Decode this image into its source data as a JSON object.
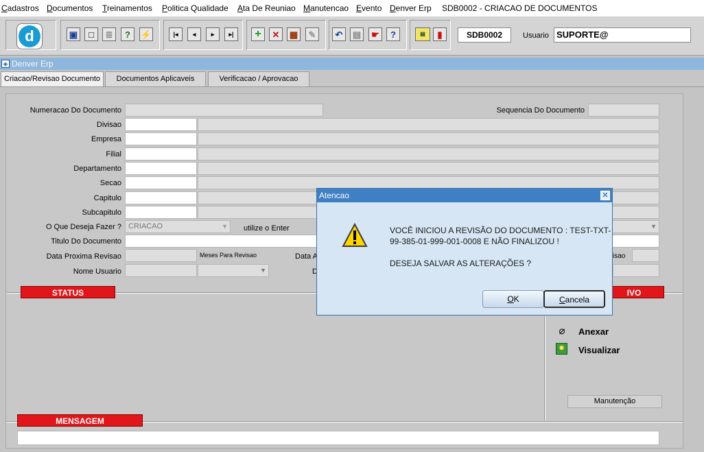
{
  "menubar": {
    "items": [
      {
        "first": "C",
        "rest": "adastros"
      },
      {
        "first": "D",
        "rest": "ocumentos"
      },
      {
        "first": "T",
        "rest": "reinamentos"
      },
      {
        "first": "P",
        "rest": "olitica Qualidade"
      },
      {
        "first": "A",
        "rest": "ta De Reuniao"
      },
      {
        "first": "M",
        "rest": "anutencao"
      },
      {
        "first": "E",
        "rest": "vento"
      },
      {
        "first": "D",
        "rest": "enver Erp"
      }
    ],
    "form_title": "SDB0002 - CRIACAO DE DOCUMENTOS"
  },
  "toolbar": {
    "form_code": "SDB0002",
    "user_label": "Usuario",
    "user_value": "SUPORTE@"
  },
  "window": {
    "title": "Denver Erp"
  },
  "tabs": [
    {
      "label": "Criacao/Revisao Documento"
    },
    {
      "label": "Documentos Aplicaveis"
    },
    {
      "label": "Verificacao / Aprovacao"
    }
  ],
  "form": {
    "numeracao_label": "Numeracao Do Documento",
    "sequencia_label": "Sequencia Do Documento",
    "divisao_label": "Divisao",
    "empresa_label": "Empresa",
    "filial_label": "Filial",
    "departamento_label": "Departamento",
    "secao_label": "Secao",
    "capitulo_label": "Capitulo",
    "subcapitulo_label": "Subcapitulo",
    "acao_label": "O Que Deseja Fazer ?",
    "acao_value": "CRIACAO",
    "acao_hint": "utilize o Enter",
    "titulo_label": "Titulo Do Documento",
    "data_proxima_label": "Data Proxima Revisao",
    "meses_label": "Meses Para Revisao",
    "data_a_partial": "Data A",
    "d_partial": "D",
    "visao_partial": "visao",
    "nome_usuario_label": "Nome Usuario"
  },
  "status": {
    "label": "STATUS"
  },
  "arquivo": {
    "label_partial": "IVO",
    "anexar": "Anexar",
    "visualizar": "Visualizar",
    "manutencao": "Manutenção"
  },
  "mensagem": {
    "label": "MENSAGEM"
  },
  "dialog": {
    "title": "Atencao",
    "line1": "VOCÊ INICIOU A REVISÃO DO DOCUMENTO : TEST-TXT-",
    "line2": "99-385-01-999-001-0008 E NÃO FINALIZOU !",
    "line3": "DESEJA SALVAR AS ALTERAÇÕES ?",
    "ok_first": "O",
    "ok_rest": "K",
    "cancel_first": "C",
    "cancel_rest": "ancela"
  },
  "colors": {
    "accent_red": "#e0161b",
    "dialog_title": "#3f7fc3",
    "window_bar": "#8fb6dc"
  }
}
